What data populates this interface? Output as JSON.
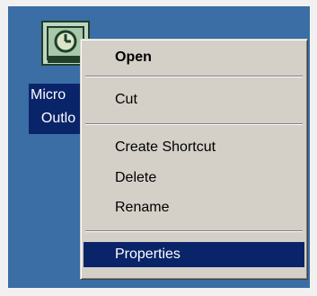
{
  "desktop_icon": {
    "icon": "outlook-express-icon",
    "label_line1": "Micro",
    "label_line2": "Outlo"
  },
  "context_menu": {
    "items": [
      {
        "label": "Open"
      },
      {
        "label": "Cut"
      },
      {
        "label": "Create Shortcut"
      },
      {
        "label": "Delete"
      },
      {
        "label": "Rename"
      },
      {
        "label": "Properties"
      }
    ]
  },
  "colors": {
    "desktop": "#3a6ea5",
    "menu_face": "#d4d0c8",
    "selection": "#0a246a",
    "frame": "#f1f1f1"
  }
}
